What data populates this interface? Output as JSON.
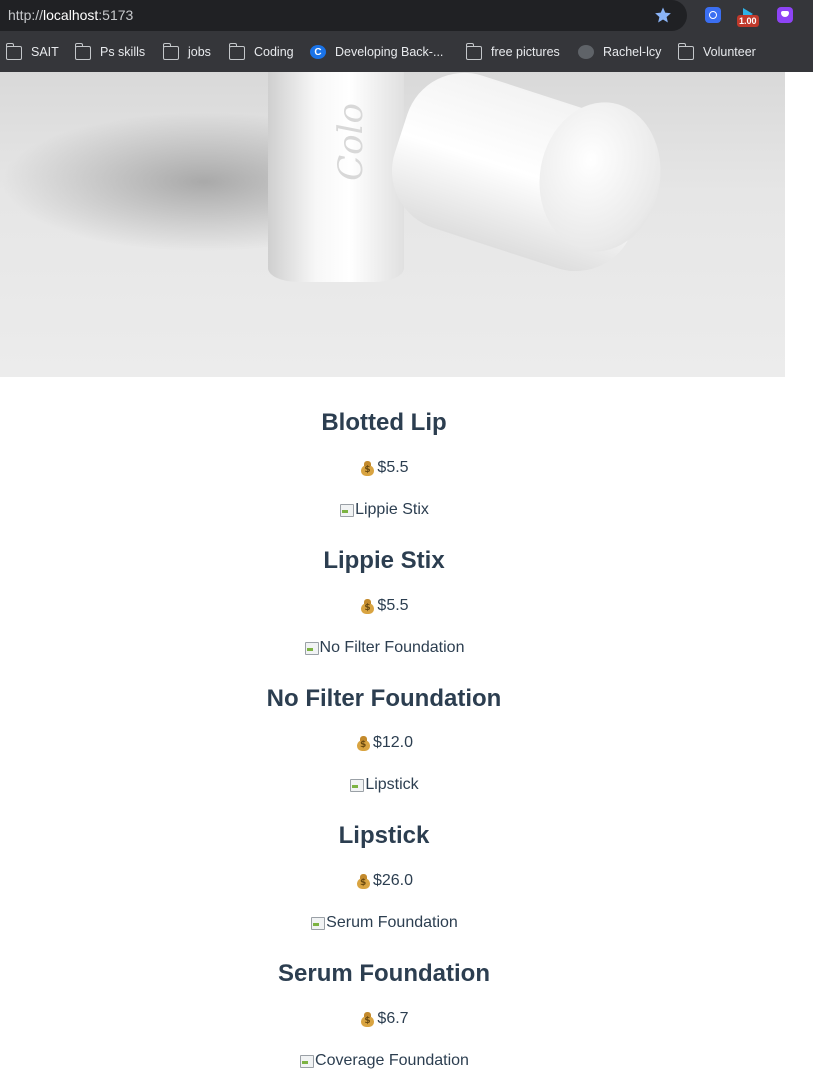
{
  "browser": {
    "url_scheme": "http://",
    "url_host": "localhost",
    "url_port": ":5173",
    "extension_badge": "1.00",
    "bookmarks": [
      {
        "label": "SAIT",
        "icon": "folder-icon"
      },
      {
        "label": "Ps skills",
        "icon": "folder-icon"
      },
      {
        "label": "jobs",
        "icon": "folder-icon"
      },
      {
        "label": "Coding",
        "icon": "folder-icon"
      },
      {
        "label": "Developing Back-...",
        "icon": "c-logo-icon"
      },
      {
        "label": "free pictures",
        "icon": "folder-icon"
      },
      {
        "label": "Rachel-lcy",
        "icon": "github-icon"
      },
      {
        "label": "Volunteer",
        "icon": "folder-icon"
      }
    ]
  },
  "hero": {
    "stick_text": "Colo"
  },
  "products": [
    {
      "name": "Blotted Lip",
      "price": "$5.5",
      "next_image_alt": "Lippie Stix"
    },
    {
      "name": "Lippie Stix",
      "price": "$5.5",
      "next_image_alt": "No Filter Foundation"
    },
    {
      "name": "No Filter Foundation",
      "price": "$12.0",
      "next_image_alt": "Lipstick"
    },
    {
      "name": "Lipstick",
      "price": "$26.0",
      "next_image_alt": "Serum Foundation"
    },
    {
      "name": "Serum Foundation",
      "price": "$6.7",
      "next_image_alt": "Coverage Foundation"
    }
  ]
}
